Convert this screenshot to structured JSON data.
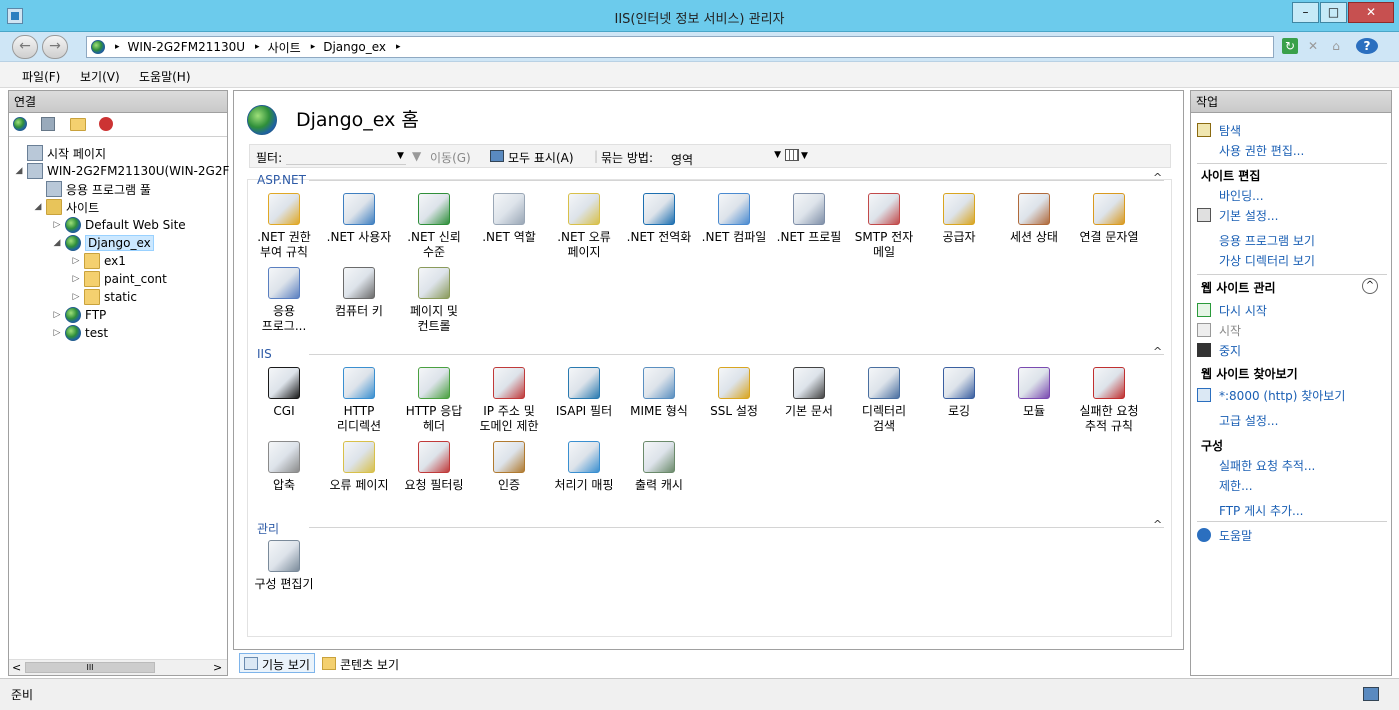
{
  "window": {
    "title": "IIS(인터넷 정보 서비스) 관리자",
    "minimize": "–",
    "maximize": "□",
    "close": "✕"
  },
  "address": {
    "crumbs": [
      "WIN-2G2FM21130U",
      "사이트",
      "Django_ex"
    ],
    "separator": "▸",
    "help_label": "?"
  },
  "menu": {
    "file": "파일(F)",
    "view": "보기(V)",
    "help": "도움말(H)"
  },
  "connections": {
    "title": "연결",
    "tree": [
      {
        "label": "시작 페이지",
        "level": 0,
        "expander": "",
        "icon": "start-page-icon"
      },
      {
        "label": "WIN-2G2FM21130U(WIN-2G2F",
        "level": 0,
        "expander": "◢",
        "icon": "server-icon"
      },
      {
        "label": "응용 프로그램 풀",
        "level": 1,
        "expander": "",
        "icon": "app-pool-icon"
      },
      {
        "label": "사이트",
        "level": 1,
        "expander": "◢",
        "icon": "sites-folder-icon"
      },
      {
        "label": "Default Web Site",
        "level": 2,
        "expander": "▷",
        "icon": "globe-icon"
      },
      {
        "label": "Django_ex",
        "level": 2,
        "expander": "◢",
        "icon": "globe-icon",
        "selected": true
      },
      {
        "label": "ex1",
        "level": 3,
        "expander": "▷",
        "icon": "folder-icon"
      },
      {
        "label": "paint_cont",
        "level": 3,
        "expander": "▷",
        "icon": "folder-icon"
      },
      {
        "label": "static",
        "level": 3,
        "expander": "▷",
        "icon": "folder-icon"
      },
      {
        "label": "FTP",
        "level": 2,
        "expander": "▷",
        "icon": "globe-icon"
      },
      {
        "label": "test",
        "level": 2,
        "expander": "▷",
        "icon": "globe-icon"
      }
    ],
    "scroll_left": "<",
    "scroll_right": ">",
    "scroll_thumb": "III"
  },
  "main": {
    "title": "Django_ex 홈",
    "filter_label": "필터:",
    "go_label": "이동(G)",
    "show_all_label": "모두 표시(A)",
    "group_by_label": "묶는 방법:",
    "group_by_value": "영역",
    "sections": [
      {
        "title": "ASP.NET",
        "features": [
          [
            ".NET 권한\n부여 규칙",
            "lock-doc-icon",
            "#e0a826"
          ],
          [
            ".NET 사용자",
            "user-icon",
            "#3f7fc0"
          ],
          [
            ".NET 신뢰\n수준",
            "globe-check-icon",
            "#2f8f3a"
          ],
          [
            ".NET 역할",
            "role-docs-icon",
            "#9aa7b6"
          ],
          [
            ".NET 오류\n페이지",
            "error-404-icon",
            "#d8c04a"
          ],
          [
            ".NET 전역화",
            "globe-icon",
            "#1d6fb0"
          ],
          [
            ".NET 컴파일",
            "compile-stack-icon",
            "#4a8ad0"
          ],
          [
            ".NET 프로필",
            "profile-icon",
            "#7f8fa8"
          ],
          [
            "SMTP 전자\n메일",
            "smtp-mail-icon",
            "#c24a4a"
          ],
          [
            "공급자",
            "providers-icon",
            "#d9a520"
          ],
          [
            "세션 상태",
            "session-icon",
            "#b06a3b"
          ],
          [
            "연결 문자열",
            "db-string-icon",
            "#d99a20"
          ],
          [
            "응용\n프로그...",
            "app-settings-icon",
            "#5a7fc0"
          ],
          [
            "컴퓨터 키",
            "machine-key-icon",
            "#6b6b6b"
          ],
          [
            "페이지 및\n컨트롤",
            "pages-controls-icon",
            "#8a9a5a"
          ]
        ]
      },
      {
        "title": "IIS",
        "features": [
          [
            "CGI",
            "cgi-icon",
            "#1a1a1a"
          ],
          [
            "HTTP\n리디렉션",
            "redirect-icon",
            "#3a8fd0"
          ],
          [
            "HTTP 응답\n헤더",
            "response-headers-icon",
            "#4aa040"
          ],
          [
            "IP 주소 및\n도메인 제한",
            "ip-restrict-icon",
            "#c03a3a"
          ],
          [
            "ISAPI 필터",
            "isapi-filter-icon",
            "#2a7ab0"
          ],
          [
            "MIME 형식",
            "mime-icon",
            "#5a8fc0"
          ],
          [
            "SSL 설정",
            "ssl-lock-icon",
            "#d9a520"
          ],
          [
            "기본 문서",
            "default-doc-icon",
            "#444444"
          ],
          [
            "디렉터리\n검색",
            "dir-browse-icon",
            "#4a6fa0"
          ],
          [
            "로깅",
            "logging-icon",
            "#3a5fa0"
          ],
          [
            "모듈",
            "modules-icon",
            "#7a4ab0"
          ],
          [
            "실패한 요청\n추적 규칙",
            "failed-req-icon",
            "#c03030"
          ],
          [
            "압축",
            "compression-icon",
            "#8a8a8a"
          ],
          [
            "오류 페이지",
            "error-pages-icon",
            "#d8c04a"
          ],
          [
            "요청 필터링",
            "req-filter-icon",
            "#c03a3a"
          ],
          [
            "인증",
            "auth-icon",
            "#b07a30"
          ],
          [
            "처리기 매핑",
            "handler-map-icon",
            "#3a8fd0"
          ],
          [
            "출력 캐시",
            "output-cache-icon",
            "#6b8a6b"
          ]
        ]
      },
      {
        "title": "관리",
        "features": [
          [
            "구성 편집기",
            "config-editor-icon",
            "#7a8a9a"
          ]
        ]
      }
    ],
    "collapse_glyph": "^"
  },
  "bottom_tabs": {
    "features_view": "기능 보기",
    "content_view": "콘텐츠 보기"
  },
  "actions": {
    "title": "작업",
    "items": [
      {
        "type": "link",
        "label": "탐색",
        "icon": "explore-icon"
      },
      {
        "type": "link",
        "label": "사용 권한 편집...",
        "icon": ""
      },
      {
        "type": "sep"
      },
      {
        "type": "header",
        "label": "사이트 편집"
      },
      {
        "type": "link",
        "label": "바인딩...",
        "icon": ""
      },
      {
        "type": "link",
        "label": "기본 설정...",
        "icon": "settings-icon"
      },
      {
        "type": "link",
        "label": "응용 프로그램 보기",
        "icon": ""
      },
      {
        "type": "link",
        "label": "가상 디렉터리 보기",
        "icon": ""
      },
      {
        "type": "sep"
      },
      {
        "type": "header",
        "label": "웹 사이트 관리"
      },
      {
        "type": "link",
        "label": "다시 시작",
        "icon": "restart-icon"
      },
      {
        "type": "disabled",
        "label": "시작",
        "icon": "start-icon"
      },
      {
        "type": "link",
        "label": "중지",
        "icon": "stop-icon"
      },
      {
        "type": "header",
        "label": "웹 사이트 찾아보기"
      },
      {
        "type": "link",
        "label": "*:8000 (http) 찾아보기",
        "icon": "browse-icon"
      },
      {
        "type": "link",
        "label": "고급 설정...",
        "icon": ""
      },
      {
        "type": "header",
        "label": "구성"
      },
      {
        "type": "link",
        "label": "실패한 요청 추적...",
        "icon": ""
      },
      {
        "type": "link",
        "label": "제한...",
        "icon": ""
      },
      {
        "type": "link",
        "label": "FTP 게시 추가...",
        "icon": ""
      },
      {
        "type": "sep"
      },
      {
        "type": "link",
        "label": "도움말",
        "icon": "help-icon"
      }
    ]
  },
  "status": {
    "text": "준비"
  },
  "colors": {
    "titlebar": "#6ccbec",
    "link": "#1a5fb4",
    "section": "#2d5aa6"
  }
}
